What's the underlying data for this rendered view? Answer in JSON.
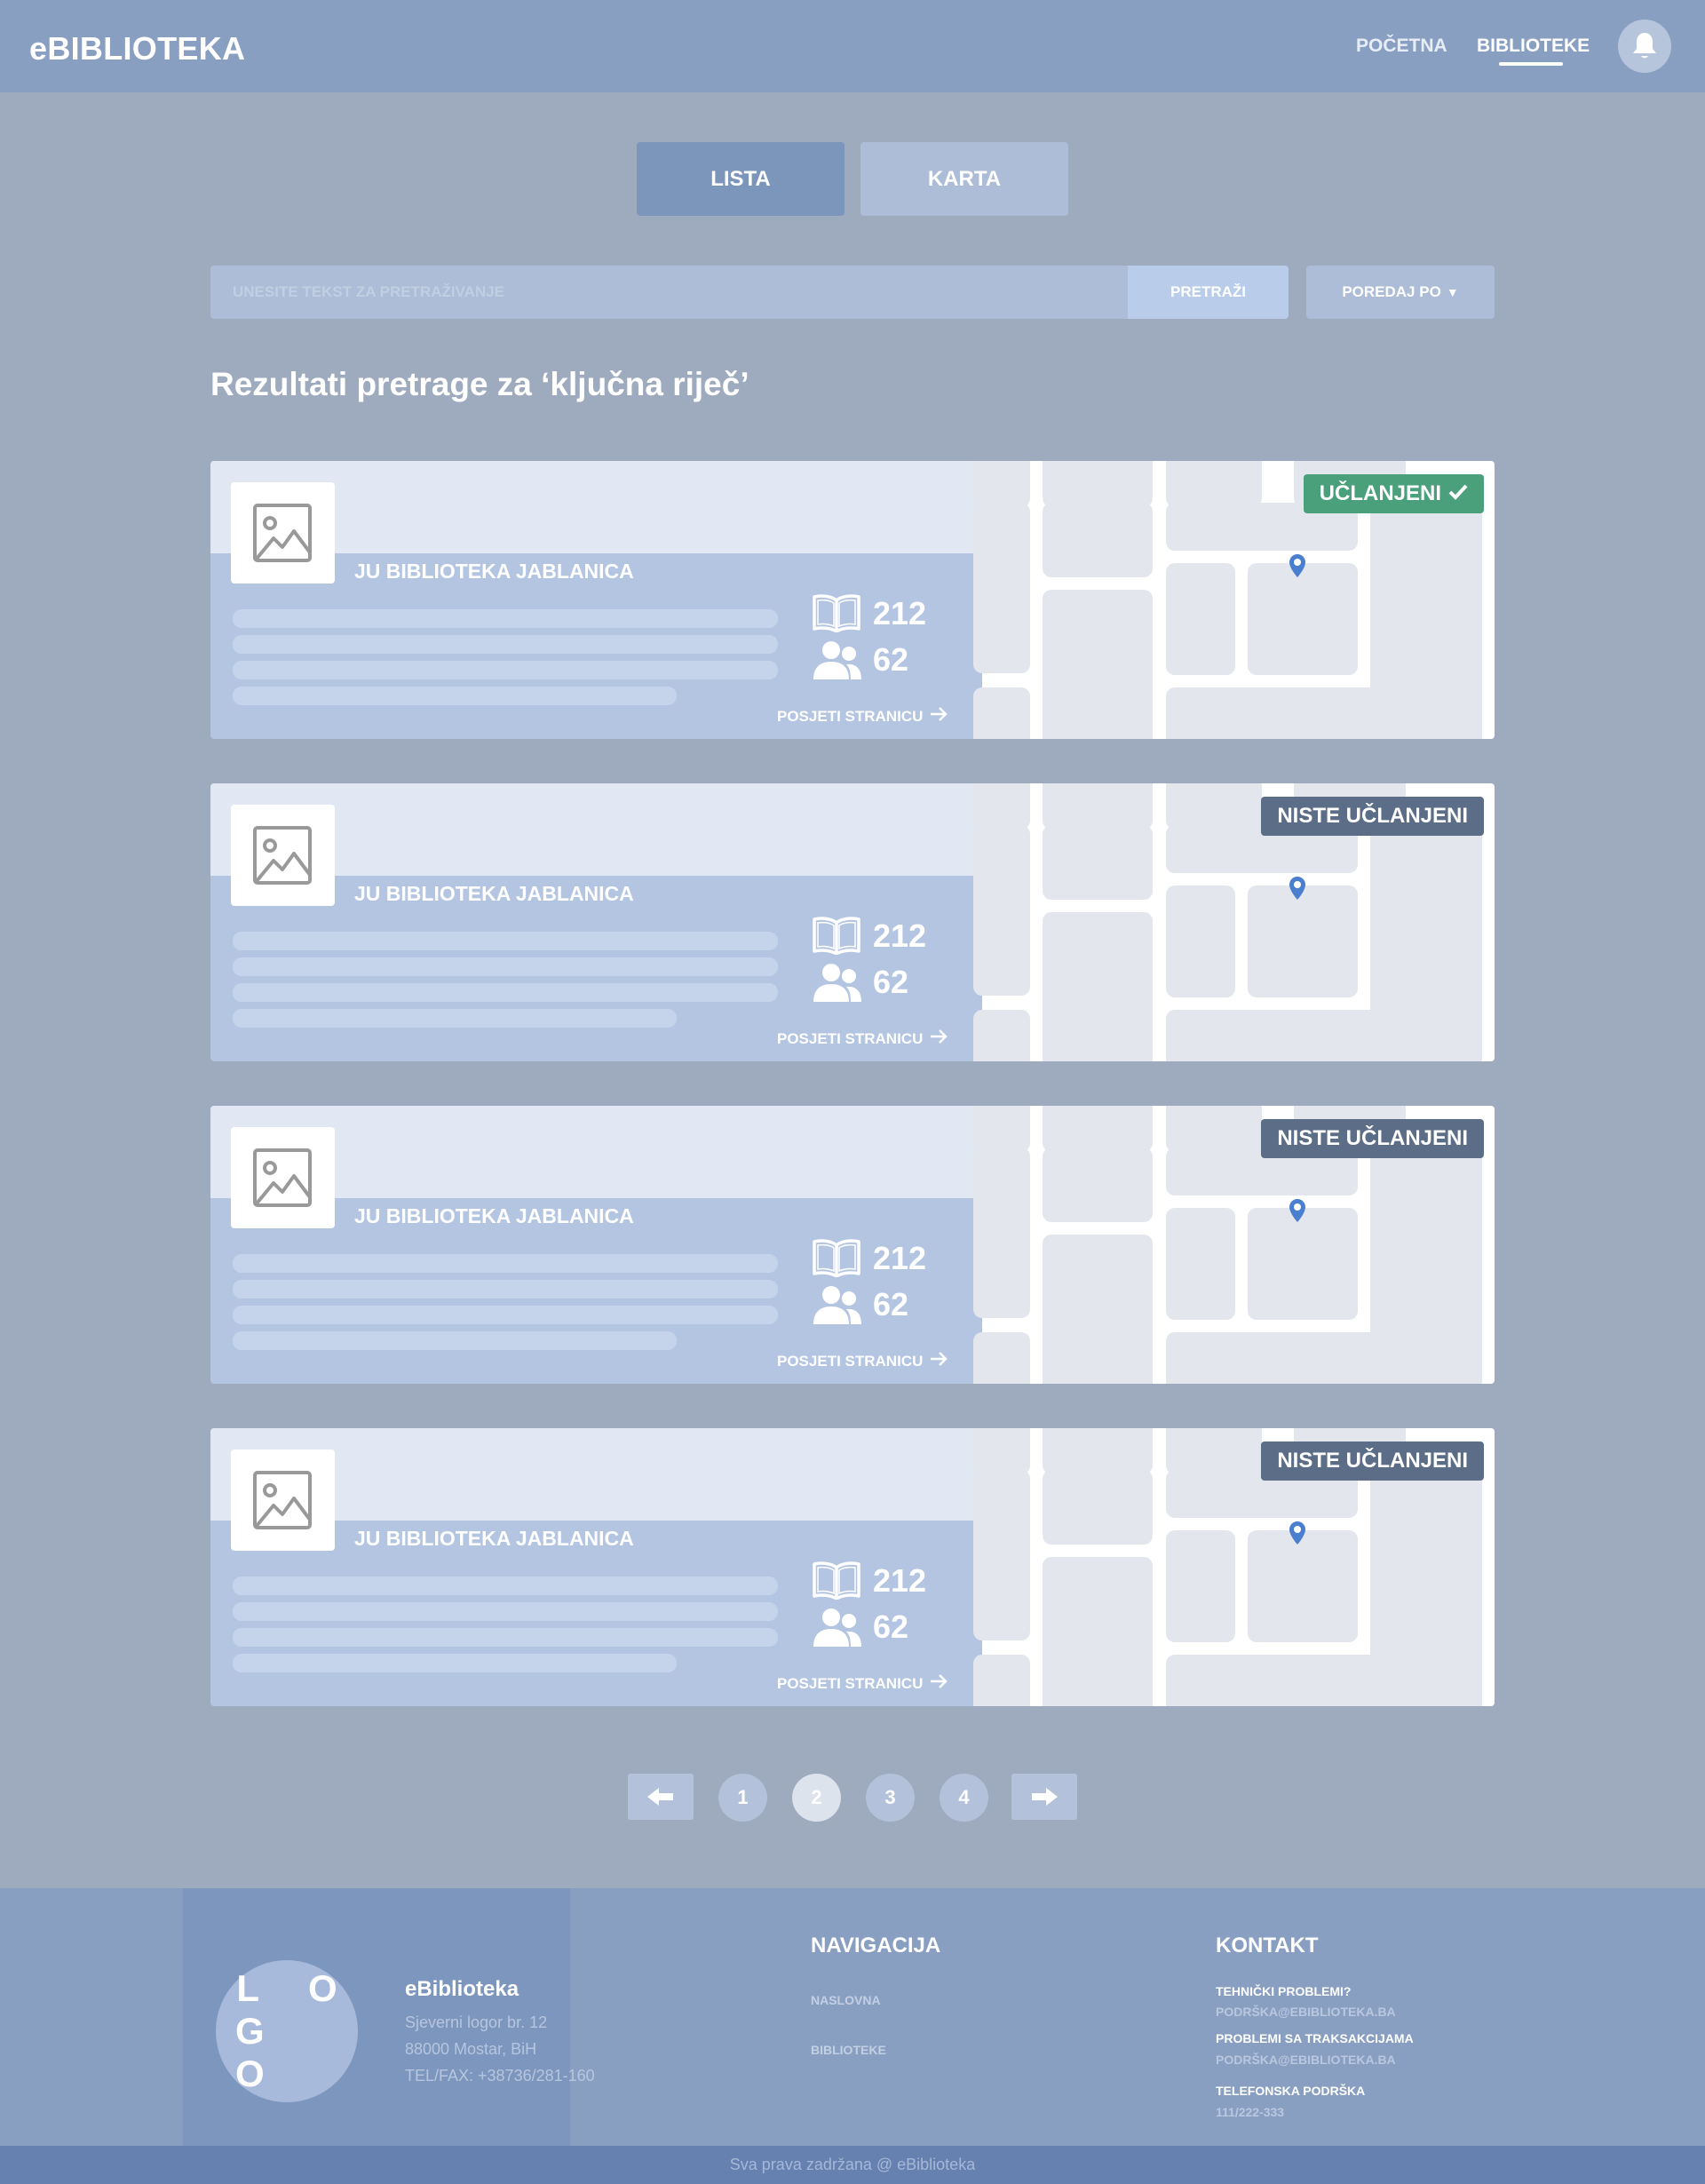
{
  "header": {
    "brand": "eBIBLIOTEKA",
    "nav": [
      {
        "label": "POČETNA"
      },
      {
        "label": "BIBLIOTEKE"
      }
    ]
  },
  "view_toggle": {
    "list_label": "LISTA",
    "map_label": "KARTA"
  },
  "search": {
    "placeholder": "UNESITE TEKST ZA PRETRAŽIVANJE",
    "button_label": "PRETRAŽI",
    "sort_label": "POREDAJ PO",
    "sort_arrow": "▼"
  },
  "results_title": "Rezultati pretrage za ‘ključna riječ’",
  "cards": [
    {
      "name": "JU BIBLIOTEKA JABLANICA",
      "books": "212",
      "members": "62",
      "link_label": "POSJETI STRANICU",
      "badge": "UČLANJENI",
      "member": true
    },
    {
      "name": "JU BIBLIOTEKA JABLANICA",
      "books": "212",
      "members": "62",
      "link_label": "POSJETI STRANICU",
      "badge": "NISTE UČLANJENI",
      "member": false
    },
    {
      "name": "JU BIBLIOTEKA JABLANICA",
      "books": "212",
      "members": "62",
      "link_label": "POSJETI STRANICU",
      "badge": "NISTE UČLANJENI",
      "member": false
    },
    {
      "name": "JU BIBLIOTEKA JABLANICA",
      "books": "212",
      "members": "62",
      "link_label": "POSJETI STRANICU",
      "badge": "NISTE UČLANJENI",
      "member": false
    }
  ],
  "pagination": {
    "pages": [
      "1",
      "2",
      "3",
      "4"
    ],
    "current": "2"
  },
  "footer": {
    "brand": "eBiblioteka",
    "address": [
      "Sjeverni logor br. 12",
      "88000 Mostar, BiH",
      "TEL/FAX: +38736/281-160"
    ],
    "logo_lines": [
      "L O",
      "G O"
    ],
    "nav_title": "NAVIGACIJA",
    "nav_links": [
      "NASLOVNA",
      "BIBLIOTEKE"
    ],
    "contact_title": "KONTAKT",
    "contacts": [
      {
        "label": "TEHNIČKI PROBLEMI?",
        "value": "PODRŠKA@EBIBLIOTEKA.BA"
      },
      {
        "label": "PROBLEMI SA TRAKSAKCIJAMA",
        "value": "PODRŠKA@EBIBLIOTEKA.BA"
      },
      {
        "label": "TELEFONSKA PODRŠKA",
        "value": "111/222-333"
      }
    ],
    "copyright": "Sva prava zadržana @ eBiblioteka"
  },
  "colors": {
    "header_bg": "#899fc2",
    "page_bg": "#9eabbe",
    "member_badge": "#4aa07a",
    "not_member_badge": "#5c6d87",
    "map_pin": "#4a7fd0"
  },
  "icons": [
    "bell-icon",
    "image-placeholder-icon",
    "book-icon",
    "users-icon",
    "arrow-right-icon",
    "map-pin-icon",
    "check-icon",
    "arrow-left-icon"
  ]
}
